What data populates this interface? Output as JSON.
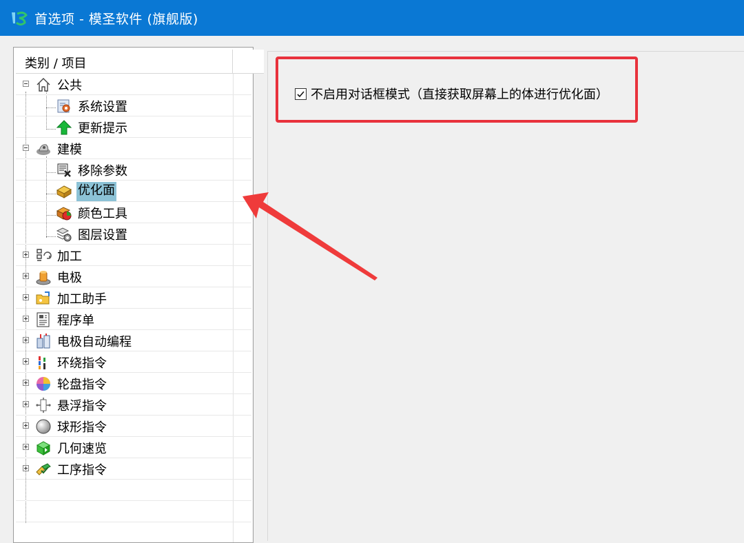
{
  "window": {
    "title": "首选项 - 模圣软件 (旗舰版)"
  },
  "tree": {
    "header": "类别 / 项目",
    "rows": [
      {
        "label": "公共",
        "icon": "home-icon",
        "level": 0,
        "expander": "minus"
      },
      {
        "label": "系统设置",
        "icon": "system-settings-icon",
        "level": 1
      },
      {
        "label": "更新提示",
        "icon": "green-up-arrow-icon",
        "level": 1
      },
      {
        "label": "建模",
        "icon": "modeling-icon",
        "level": 0,
        "expander": "minus"
      },
      {
        "label": "移除参数",
        "icon": "remove-params-icon",
        "level": 1
      },
      {
        "label": "优化面",
        "icon": "optimize-face-icon",
        "level": 1,
        "selected": true
      },
      {
        "label": "颜色工具",
        "icon": "color-tool-icon",
        "level": 1
      },
      {
        "label": "图层设置",
        "icon": "layer-settings-icon",
        "level": 1
      },
      {
        "label": "加工",
        "icon": "machining-icon",
        "level": 0,
        "expander": "plus"
      },
      {
        "label": "电极",
        "icon": "electrode-icon",
        "level": 0,
        "expander": "plus"
      },
      {
        "label": "加工助手",
        "icon": "folder-assistant-icon",
        "level": 0,
        "expander": "plus"
      },
      {
        "label": "程序单",
        "icon": "program-sheet-icon",
        "level": 0,
        "expander": "plus"
      },
      {
        "label": "电极自动编程",
        "icon": "electrode-auto-program-icon",
        "level": 0,
        "expander": "plus"
      },
      {
        "label": "环绕指令",
        "icon": "surround-command-icon",
        "level": 0,
        "expander": "plus"
      },
      {
        "label": "轮盘指令",
        "icon": "wheel-command-icon",
        "level": 0,
        "expander": "plus"
      },
      {
        "label": "悬浮指令",
        "icon": "float-command-icon",
        "level": 0,
        "expander": "plus"
      },
      {
        "label": "球形指令",
        "icon": "sphere-command-icon",
        "level": 0,
        "expander": "plus"
      },
      {
        "label": "几何速览",
        "icon": "geometry-preview-icon",
        "level": 0,
        "expander": "plus"
      },
      {
        "label": "工序指令",
        "icon": "process-command-icon",
        "level": 0,
        "expander": "plus"
      }
    ]
  },
  "options": {
    "no_dialog_mode": {
      "label": "不启用对话框模式（直接获取屏幕上的体进行优化面）",
      "checked": true
    }
  },
  "colors": {
    "titlebar": "#0a78d4",
    "selection": "#8cc2d6",
    "annotation": "#e8323c"
  }
}
